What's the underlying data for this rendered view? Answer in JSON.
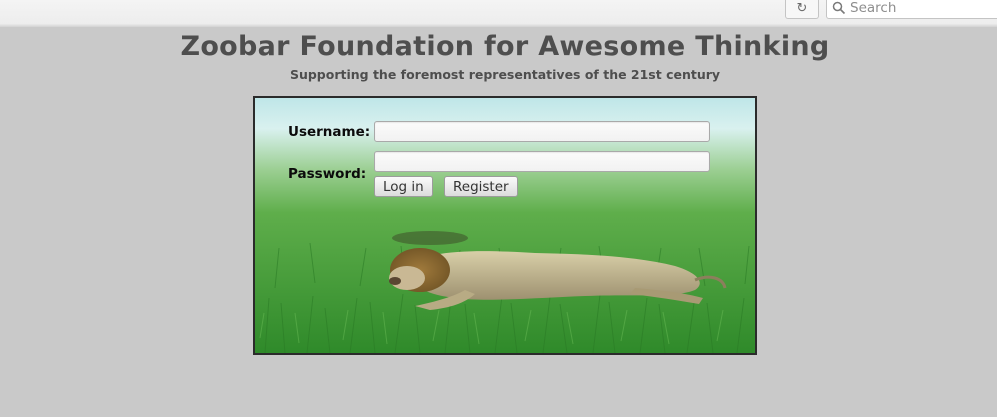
{
  "browser": {
    "search_placeholder": "Search",
    "reload_glyph": "↻",
    "search_glyph": "⚲"
  },
  "header": {
    "title": "Zoobar Foundation for Awesome Thinking",
    "subtitle": "Supporting the foremost representatives of the 21st century"
  },
  "login": {
    "username_label": "Username:",
    "password_label": "Password:",
    "username_value": "",
    "password_value": "",
    "login_button": "Log in",
    "register_button": "Register"
  },
  "colors": {
    "page_background": "#c9c9c9",
    "heading_text": "#4e4e4e",
    "grass": "#3f9a34",
    "sky_haze": "#d8f0f0"
  },
  "icons": {
    "reload": "reload-icon",
    "search": "search-icon"
  }
}
